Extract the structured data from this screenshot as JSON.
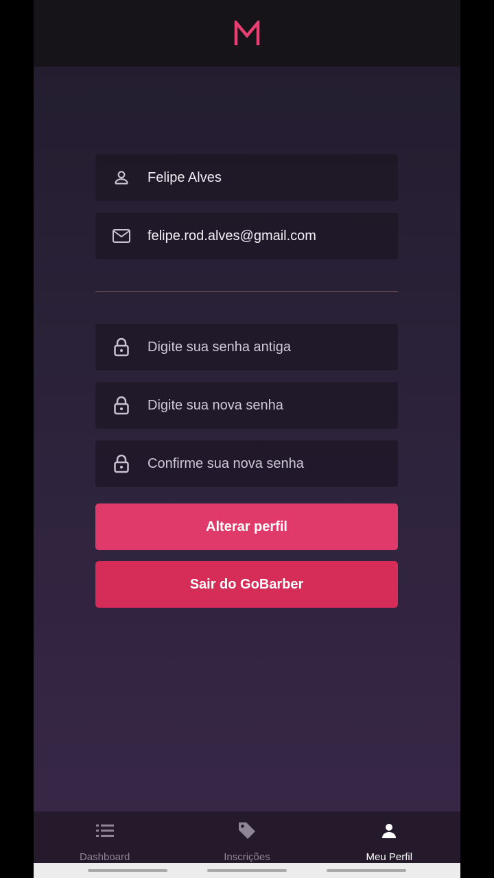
{
  "header": {
    "logo_icon": "m-logo-icon",
    "brand_color": "#e83f73"
  },
  "profile": {
    "name": "Felipe Alves",
    "email": "felipe.rod.alves@gmail.com",
    "name_icon": "user-icon",
    "email_icon": "mail-icon"
  },
  "password": {
    "old_placeholder": "Digite sua senha antiga",
    "new_placeholder": "Digite sua nova senha",
    "confirm_placeholder": "Confirme sua nova senha",
    "icon": "lock-icon"
  },
  "buttons": {
    "update_label": "Alterar perfil",
    "logout_label": "Sair do GoBarber",
    "update_color": "#e03a6b",
    "logout_color": "#d52c58"
  },
  "tabs": [
    {
      "label": "Dashboard",
      "icon": "list-icon",
      "active": false
    },
    {
      "label": "Inscrições",
      "icon": "tag-icon",
      "active": false
    },
    {
      "label": "Meu Perfil",
      "icon": "person-icon",
      "active": true
    }
  ]
}
